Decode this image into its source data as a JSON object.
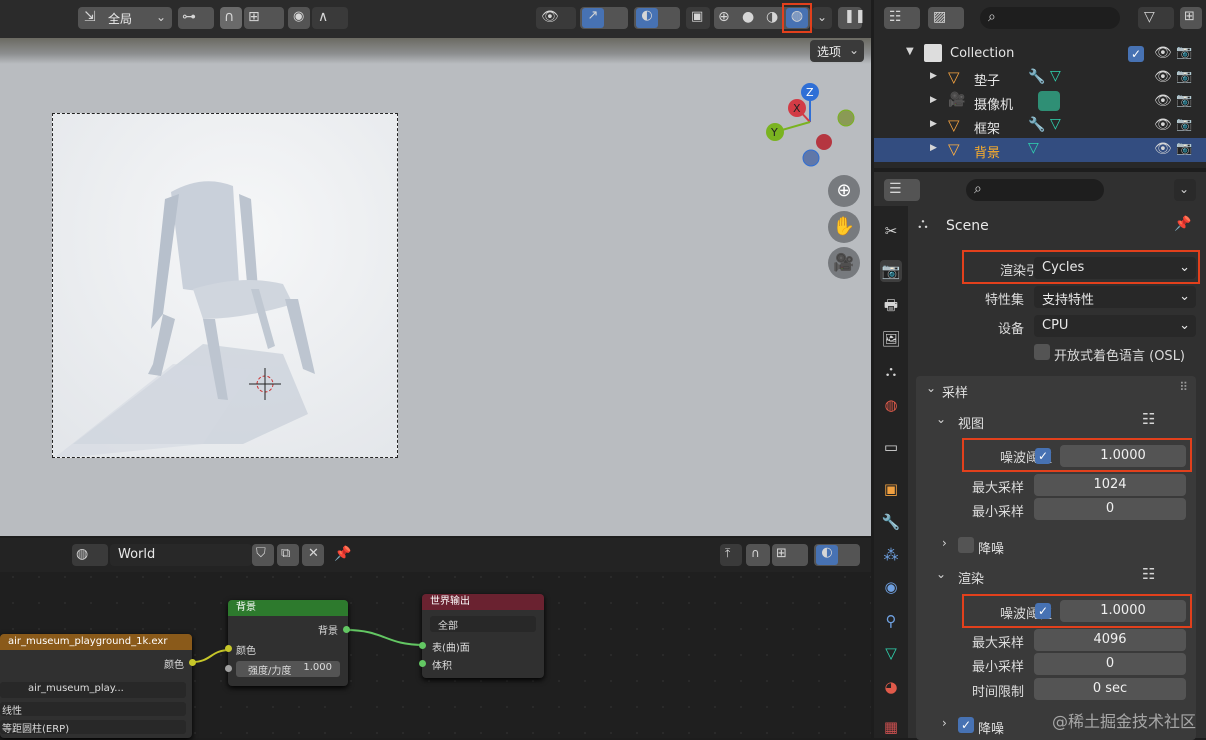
{
  "viewport": {
    "header": {
      "transform_orientation": "全局",
      "options_label": "选项"
    }
  },
  "outliner": {
    "collection": "Collection",
    "items": [
      {
        "label": "垫子",
        "selected": false
      },
      {
        "label": "摄像机",
        "selected": false
      },
      {
        "label": "框架",
        "selected": false
      },
      {
        "label": "背景",
        "selected": true
      }
    ]
  },
  "properties": {
    "scene_label": "Scene",
    "render_engine_label": "渲染引擎",
    "render_engine_value": "Cycles",
    "feature_set_label": "特性集",
    "feature_set_value": "支持特性",
    "device_label": "设备",
    "device_value": "CPU",
    "osl_label": "开放式着色语言 (OSL)",
    "sampling": {
      "title": "采样",
      "viewport": {
        "title": "视图",
        "noise_threshold_label": "噪波阈值",
        "noise_threshold_value": "1.0000",
        "max_samples_label": "最大采样",
        "max_samples_value": "1024",
        "min_samples_label": "最小采样",
        "min_samples_value": "0",
        "denoise_label": "降噪"
      },
      "render": {
        "title": "渲染",
        "noise_threshold_label": "噪波阈值",
        "noise_threshold_value": "1.0000",
        "max_samples_label": "最大采样",
        "max_samples_value": "4096",
        "min_samples_label": "最小采样",
        "min_samples_value": "0",
        "time_limit_label": "时间限制",
        "time_limit_value": "0 sec",
        "denoise_label": "降噪"
      }
    }
  },
  "node_editor": {
    "world_name": "World",
    "env_node": {
      "title": "air_museum_playground_1k.exr",
      "color_out": "颜色",
      "image_name": "air_museum_play...",
      "interp": "线性",
      "projection": "等距圆柱(ERP)"
    },
    "bg_node": {
      "title": "背景",
      "out": "背景",
      "color_in": "颜色",
      "strength_label": "强度/力度",
      "strength_value": "1.000"
    },
    "output_node": {
      "title": "世界输出",
      "target": "全部",
      "surface": "表(曲)面",
      "volume": "体积"
    }
  },
  "watermark": "@稀土掘金技术社区",
  "colors": {
    "accent": "#4772b3",
    "highlight": "#e2401c",
    "selected_row": "#334d80"
  }
}
